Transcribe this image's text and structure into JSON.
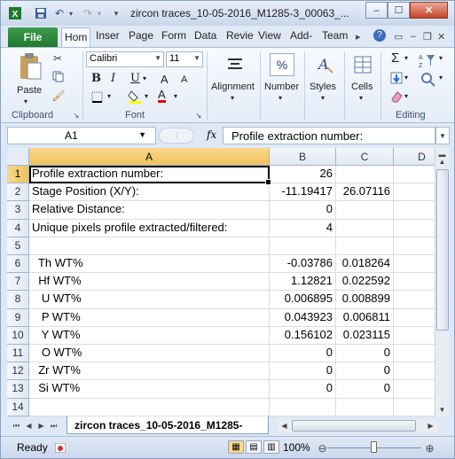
{
  "window": {
    "title": "zircon traces_10-05-2016_M1285-3_00063_...",
    "minimize_label": "–",
    "maximize_label": "☐",
    "close_label": "✕"
  },
  "quick_access": {
    "save_icon": "save-icon",
    "undo_icon": "undo-icon",
    "redo_icon": "redo-icon"
  },
  "tabs": {
    "file": "File",
    "items": [
      "Hom",
      "Inser",
      "Page",
      "Form",
      "Data",
      "Revie",
      "View",
      "Add-",
      "Team"
    ],
    "active": "Hom"
  },
  "ribbon": {
    "clipboard": {
      "label": "Clipboard",
      "paste_label": "Paste"
    },
    "font": {
      "label": "Font",
      "font_name": "Calibri",
      "font_size": "11",
      "bold": "B",
      "italic": "I",
      "underline": "U",
      "grow": "A",
      "shrink": "A",
      "color_letter": "A"
    },
    "alignment": {
      "label": "Alignment"
    },
    "number": {
      "label": "Number",
      "symbol": "%"
    },
    "styles": {
      "label": "Styles"
    },
    "cells": {
      "label": "Cells"
    },
    "editing": {
      "label": "Editing",
      "sum": "Σ"
    }
  },
  "formula_bar": {
    "name_box": "A1",
    "fx": "fx",
    "value": "Profile extraction number:"
  },
  "columns": [
    "A",
    "B",
    "C",
    "D"
  ],
  "selected_column": "A",
  "rows": [
    {
      "n": "1",
      "a": "Profile extraction number:",
      "b": "26",
      "c": ""
    },
    {
      "n": "2",
      "a": "Stage Position (X/Y):",
      "b": "-11.19417",
      "c": "26.07116"
    },
    {
      "n": "3",
      "a": "Relative Distance:",
      "b": "0",
      "c": ""
    },
    {
      "n": "4",
      "a": "Unique pixels profile extracted/filtered:",
      "b": "4",
      "c": ""
    },
    {
      "n": "5",
      "a": "",
      "b": "",
      "c": ""
    },
    {
      "n": "6",
      "a": "  Th WT%",
      "b": "-0.03786",
      "c": "0.018264"
    },
    {
      "n": "7",
      "a": "  Hf WT%",
      "b": "1.12821",
      "c": "0.022592"
    },
    {
      "n": "8",
      "a": "   U WT%",
      "b": "0.006895",
      "c": "0.008899"
    },
    {
      "n": "9",
      "a": "   P WT%",
      "b": "0.043923",
      "c": "0.006811"
    },
    {
      "n": "10",
      "a": "   Y WT%",
      "b": "0.156102",
      "c": "0.023115"
    },
    {
      "n": "11",
      "a": "   O WT%",
      "b": "0",
      "c": "0"
    },
    {
      "n": "12",
      "a": "  Zr WT%",
      "b": "0",
      "c": "0"
    },
    {
      "n": "13",
      "a": "  Si WT%",
      "b": "0",
      "c": "0"
    },
    {
      "n": "14",
      "a": "",
      "b": "",
      "c": ""
    }
  ],
  "sheet_tab": "zircon traces_10-05-2016_M1285-",
  "status": {
    "ready": "Ready",
    "zoom": "100%"
  }
}
